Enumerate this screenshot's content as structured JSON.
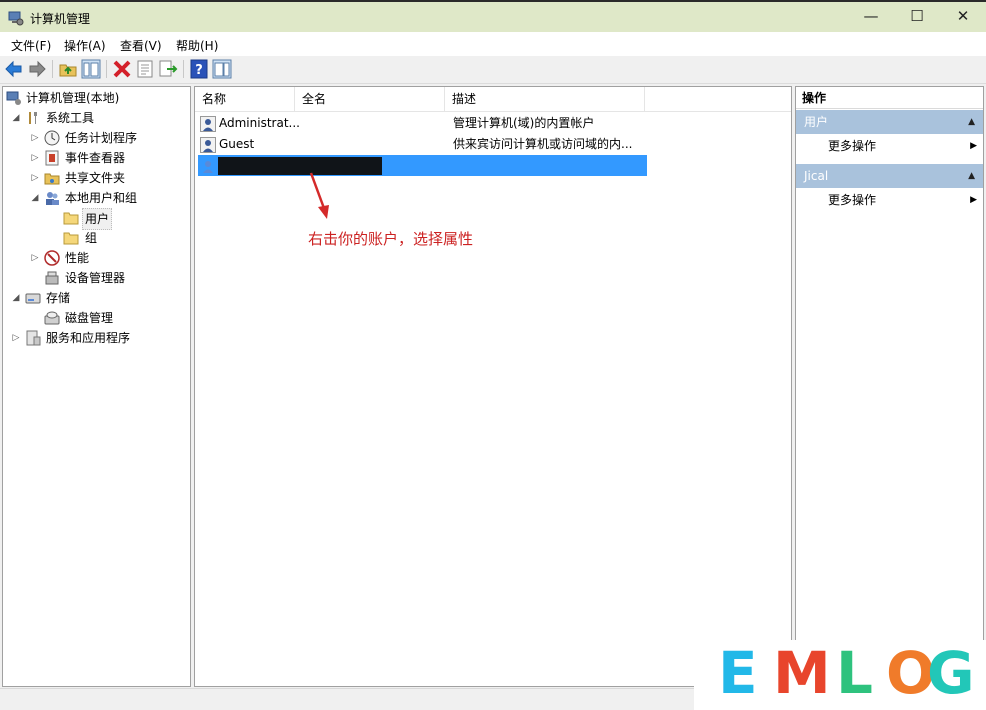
{
  "window": {
    "title": "计算机管理",
    "controls": {
      "minimize": "—",
      "maximize": "☐",
      "close": "✕"
    }
  },
  "menu": [
    "文件(F)",
    "操作(A)",
    "查看(V)",
    "帮助(H)"
  ],
  "toolbar": {
    "icons": [
      "back-arrow-icon",
      "forward-arrow-icon",
      "up-folder-icon",
      "show-hide-tree-icon",
      "delete-icon",
      "properties-icon",
      "export-list-icon",
      "help-icon",
      "show-hide-action-pane-icon"
    ]
  },
  "tree": {
    "root": "计算机管理(本地)",
    "system_tools": "系统工具",
    "task_scheduler": "任务计划程序",
    "event_viewer": "事件查看器",
    "shared_folders": "共享文件夹",
    "local_users_groups": "本地用户和组",
    "users": "用户",
    "groups": "组",
    "performance": "性能",
    "device_manager": "设备管理器",
    "storage": "存储",
    "disk_management": "磁盘管理",
    "services_apps": "服务和应用程序"
  },
  "list": {
    "columns": {
      "name": "名称",
      "fullname": "全名",
      "description": "描述"
    },
    "rows": [
      {
        "name": "Administrat...",
        "fullname": "",
        "description": "管理计算机(域)的内置帐户"
      },
      {
        "name": "Guest",
        "fullname": "",
        "description": "供来宾访问计算机或访问域的内..."
      },
      {
        "name": "",
        "fullname": "",
        "description": ""
      }
    ],
    "annotation": "右击你的账户，选择属性"
  },
  "actions": {
    "header": "操作",
    "groups": [
      {
        "title": "用户",
        "item": "更多操作"
      },
      {
        "title": "Jical",
        "item": "更多操作"
      }
    ]
  },
  "watermark": {
    "letters": [
      "E",
      "M",
      "L",
      "O",
      "G"
    ],
    "colors": [
      "#22b8e8",
      "#e8452c",
      "#2ec27e",
      "#f07b2a",
      "#22c7b8"
    ]
  },
  "colors": {
    "selection": "#3399ff",
    "titlebar": "#dfe8c8",
    "action_group": "#a9c2dc",
    "annotation": "#cc2222"
  }
}
